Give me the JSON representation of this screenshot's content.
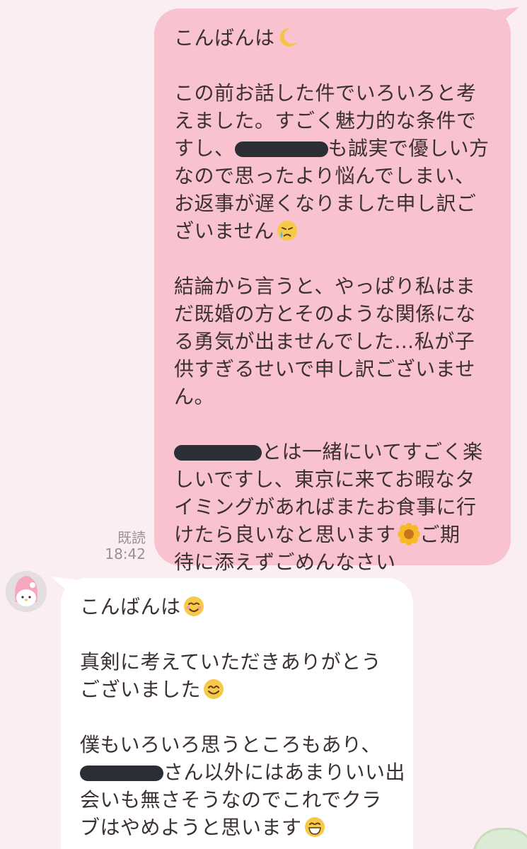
{
  "chat": {
    "outgoing": {
      "read_label": "既読",
      "time": "18:42",
      "greeting": "こんばんは",
      "p1_l1": "この前お話した件でいろいろと考",
      "p1_l2": "えました。すごく魅力的な条件で",
      "p1_l3_pre": "すし、",
      "p1_l3_post": "も誠実で優しい方",
      "p1_l4": "なので思ったより悩んでしまい、",
      "p1_l5": "お返事が遅くなりました申し訳ご",
      "p1_l6": "ざいません",
      "p2_l1": "結論から言うと、やっぱり私はま",
      "p2_l2": "だ既婚の方とそのような関係にな",
      "p2_l3": "る勇気が出ませんでした…私が子",
      "p2_l4": "供すぎるせいで申し訳ございませ",
      "p2_l5": "ん。",
      "p3_l1_post": "とは一緒にいてすごく楽",
      "p3_l2": "しいですし、東京に来てお暇なタ",
      "p3_l3": "イミングがあればまたお食事に行",
      "p3_l4": "けたら良いなと思います",
      "p3_l4_post": "ご期",
      "p3_l5": "待に添えずごめんなさい"
    },
    "incoming": {
      "greeting": "こんばんは",
      "p1_l1": "真剣に考えていただきありがとう",
      "p1_l2": "ございました",
      "p2_l1": "僕もいろいろ思うところもあり、",
      "p2_l2_post": "さん以外にはあまりいい出",
      "p2_l3": "会いも無さそうなのでこれでクラ",
      "p2_l4": "ブはやめようと思います"
    },
    "emoji": {
      "moon": "crescent-moon-icon",
      "crying": "crying-face-icon",
      "flower": "sunflower-icon",
      "relieved": "smiling-face-icon",
      "smile": "smiling-face-with-smiling-eyes-icon",
      "grin": "grinning-face-icon"
    },
    "colors": {
      "outgoing_bubble": "#f9c2cf",
      "incoming_bubble": "#ffffff",
      "background": "#fbeef2",
      "redaction": "#2b2e35"
    }
  }
}
